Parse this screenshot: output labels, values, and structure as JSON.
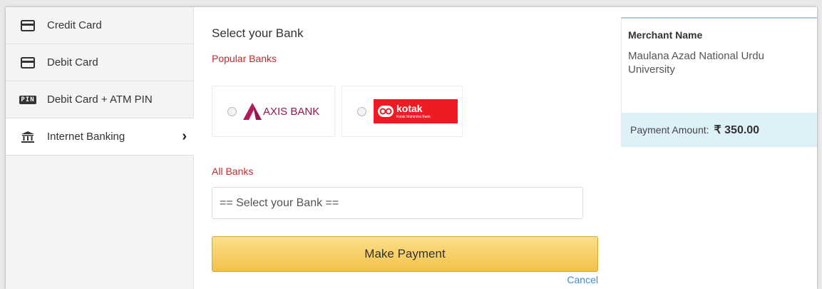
{
  "sidebar": {
    "items": [
      {
        "label": "Credit Card",
        "icon": "card-icon"
      },
      {
        "label": "Debit Card",
        "icon": "card-icon"
      },
      {
        "label": "Debit Card + ATM PIN",
        "icon": "pin-icon",
        "badge": "PIN"
      },
      {
        "label": "Internet Banking",
        "icon": "bank-icon",
        "active": true,
        "arrow": "›"
      }
    ]
  },
  "main": {
    "title": "Select your Bank",
    "popular_label": "Popular Banks",
    "popular_banks": [
      {
        "name": "AXIS BANK"
      },
      {
        "name": "kotak",
        "sub": "Kotak Mahindra Bank"
      }
    ],
    "all_label": "All Banks",
    "select_bank": "== Select your Bank ==",
    "pay_button": "Make Payment",
    "cancel": "Cancel"
  },
  "merchant": {
    "label": "Merchant Name",
    "value": "Maulana Azad National Urdu University",
    "amount_label": "Payment Amount:",
    "amount_value": "₹ 350.00"
  },
  "colors": {
    "accent_red": "#c7282e",
    "link_blue": "#3b8fd0",
    "axis_brand": "#97144d",
    "kotak_brand": "#ed1c24",
    "button_yellow": "#f3c14a"
  }
}
